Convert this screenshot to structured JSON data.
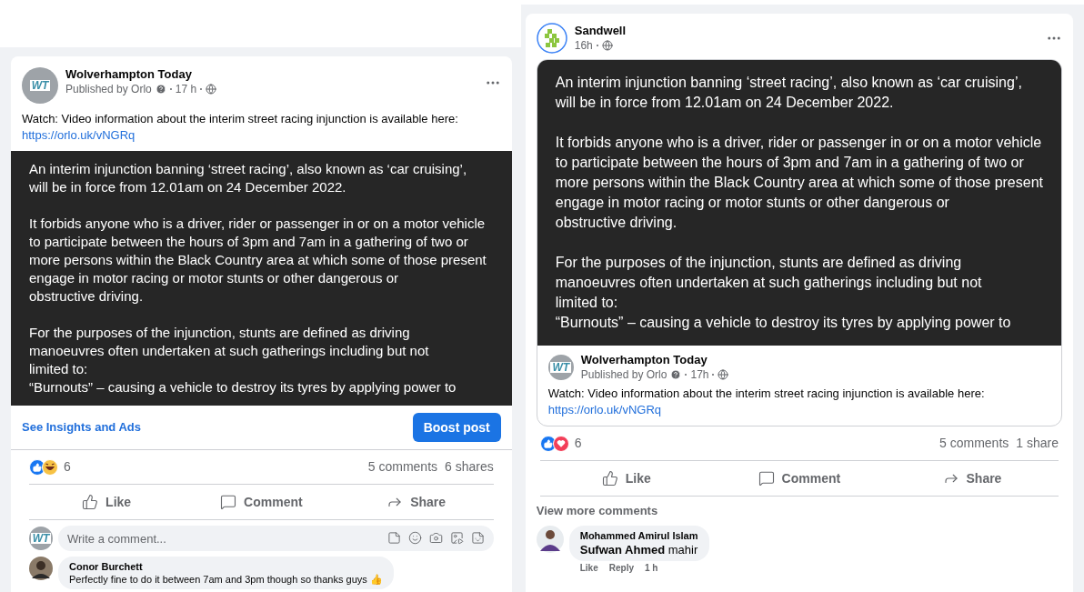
{
  "posts": [
    {
      "page": "Wolverhampton Today",
      "avatar_text": "WT",
      "byline": "Published by Orlo",
      "time": "17 h",
      "caption": "Watch: Video information about the interim street racing injunction is available here:",
      "link": "https://orlo.uk/vNGRq",
      "image_paragraphs": [
        [
          "An interim injunction banning ‘street racing’, also known as ‘car cruising’,",
          "will be in force from 12.01am on 24 December 2022."
        ],
        [
          "It forbids anyone who is a driver, rider or passenger in or on a motor vehicle",
          "to participate between the hours of 3pm and 7am in a gathering of two or",
          "more persons within the Black Country area at which some of those present",
          "engage in motor racing or motor stunts or other dangerous or",
          "obstructive driving."
        ],
        [
          "For the purposes of the injunction, stunts are defined as driving",
          "manoeuvres often undertaken at such gatherings including but not",
          "limited to:",
          "“Burnouts” – causing a vehicle to destroy its tyres by applying power to"
        ]
      ],
      "insights_link": "See Insights and Ads",
      "boost_button": "Boost post",
      "reactions": [
        {
          "kind": "like"
        },
        {
          "kind": "haha"
        }
      ],
      "reaction_count": "6",
      "comments_count": "5 comments",
      "shares_count": "6 shares",
      "actions": [
        {
          "kind": "like",
          "label": "Like"
        },
        {
          "kind": "comment",
          "label": "Comment"
        },
        {
          "kind": "share",
          "label": "Share"
        }
      ],
      "comment_box": {
        "avatar_text": "WT",
        "placeholder": "Write a comment..."
      },
      "comments": [
        {
          "author": "Conor Burchett",
          "text": "Perfectly fine to do it between 7am and 3pm though so thanks guys 👍"
        }
      ]
    },
    {
      "page": "Sandwell",
      "time": "16h",
      "image_paragraphs": [
        [
          "An interim injunction banning ‘street racing’, also known as ‘car cruising’,",
          "will be in force from 12.01am on 24 December 2022."
        ],
        [
          "It forbids anyone who is a driver, rider or passenger in or on a motor vehicle",
          "to participate between the hours of 3pm and 7am in a gathering of two or",
          "more persons within the Black Country area at which some of those present",
          "engage in motor racing or motor stunts or other dangerous or",
          "obstructive driving."
        ],
        [
          "For the purposes of the injunction, stunts are defined as driving",
          "manoeuvres often undertaken at such gatherings including but not",
          "limited to:",
          "“Burnouts” – causing a vehicle to destroy its tyres by applying power to"
        ]
      ],
      "shared": {
        "page": "Wolverhampton Today",
        "avatar_text": "WT",
        "byline": "Published by Orlo",
        "time": "17h",
        "caption": "Watch: Video information about the interim street racing injunction is available here:",
        "link": "https://orlo.uk/vNGRq"
      },
      "reactions": [
        {
          "kind": "like"
        },
        {
          "kind": "love"
        }
      ],
      "reaction_count": "6",
      "comments_count": "5 comments",
      "shares_count": "1 share",
      "actions": [
        {
          "kind": "like",
          "label": "Like"
        },
        {
          "kind": "comment",
          "label": "Comment"
        },
        {
          "kind": "share",
          "label": "Share"
        }
      ],
      "view_more": "View more comments",
      "comments": [
        {
          "author": "Mohammed Amirul Islam",
          "text": "**Sufwan Ahmed** mahir",
          "meta": [
            "Like",
            "Reply",
            "1 h"
          ]
        }
      ]
    }
  ]
}
